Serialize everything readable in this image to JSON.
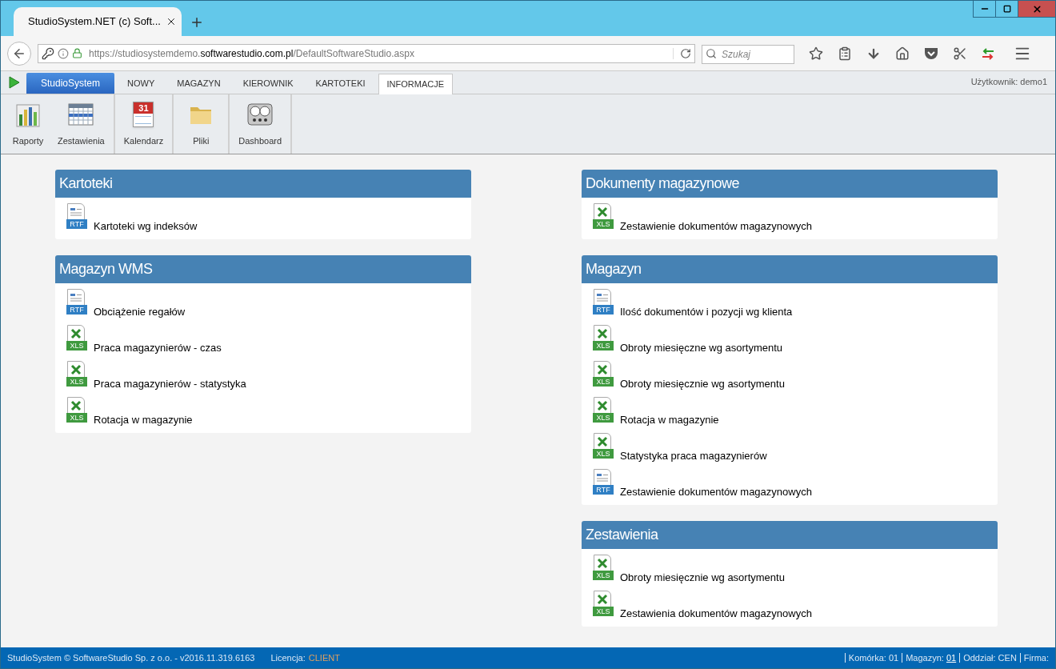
{
  "browser": {
    "tab_title": "StudioSystem.NET (c) Soft...",
    "url_prefix": "https://studiosystemdemo.",
    "url_domain": "softwarestudio.com.pl",
    "url_path": "/DefaultSoftwareStudio.aspx",
    "search_placeholder": "Szukaj"
  },
  "app_menu": {
    "brand": "StudioSystem",
    "tabs": [
      {
        "label": "NOWY",
        "selected": false
      },
      {
        "label": "MAGAZYN",
        "selected": false
      },
      {
        "label": "KIEROWNIK",
        "selected": false
      },
      {
        "label": "KARTOTEKI",
        "selected": false
      },
      {
        "label": "INFORMACJE",
        "selected": true
      }
    ],
    "user": "Użytkownik: demo1"
  },
  "ribbon": [
    {
      "items": [
        {
          "kind": "chart",
          "label": "Raporty"
        },
        {
          "kind": "grid",
          "label": "Zestawienia"
        }
      ]
    },
    {
      "items": [
        {
          "kind": "calendar",
          "label": "Kalendarz",
          "badge": "31"
        }
      ]
    },
    {
      "items": [
        {
          "kind": "folder",
          "label": "Pliki"
        }
      ]
    },
    {
      "items": [
        {
          "kind": "gauges",
          "label": "Dashboard"
        }
      ]
    }
  ],
  "columns": [
    [
      {
        "title": "Kartoteki",
        "items": [
          {
            "kind": "rtf",
            "badge": "RTF",
            "label": "Kartoteki wg indeksów"
          }
        ]
      },
      {
        "title": "Magazyn WMS",
        "items": [
          {
            "kind": "rtf",
            "badge": "RTF",
            "label": "Obciążenie regałów"
          },
          {
            "kind": "xls",
            "badge": "XLS",
            "label": "Praca magazynierów - czas"
          },
          {
            "kind": "xls",
            "badge": "XLS",
            "label": "Praca magazynierów - statystyka"
          },
          {
            "kind": "xls",
            "badge": "XLS",
            "label": "Rotacja w magazynie"
          }
        ]
      }
    ],
    [
      {
        "title": "Dokumenty magazynowe",
        "items": [
          {
            "kind": "xls",
            "badge": "XLS",
            "label": "Zestawienie dokumentów magazynowych"
          }
        ]
      },
      {
        "title": "Magazyn",
        "items": [
          {
            "kind": "rtf",
            "badge": "RTF",
            "label": "Ilość dokumentów i pozycji wg klienta"
          },
          {
            "kind": "xls",
            "badge": "XLS",
            "label": "Obroty miesięczne wg asortymentu"
          },
          {
            "kind": "xls",
            "badge": "XLS",
            "label": "Obroty miesięcznie wg asortymentu"
          },
          {
            "kind": "xls",
            "badge": "XLS",
            "label": "Rotacja w magazynie"
          },
          {
            "kind": "xls",
            "badge": "XLS",
            "label": "Statystyka praca magazynierów"
          },
          {
            "kind": "rtf",
            "badge": "RTF",
            "label": "Zestawienie dokumentów magazynowych"
          }
        ]
      },
      {
        "title": "Zestawienia",
        "items": [
          {
            "kind": "xls",
            "badge": "XLS",
            "label": "Obroty miesięcznie wg asortymentu"
          },
          {
            "kind": "xls",
            "badge": "XLS",
            "label": "Zestawienia dokumentów magazynowych"
          }
        ]
      }
    ]
  ],
  "status_bar": {
    "copyright": "StudioSystem © SoftwareStudio Sp. z o.o. - v2016.11.319.6163",
    "license_label": "Licencja:",
    "license_value": "CLIENT",
    "fields": [
      {
        "label": "Komórka: 01"
      },
      {
        "label": "Magazyn:",
        "link": "01"
      },
      {
        "label": "Oddział: CEN"
      },
      {
        "label": "Firma:"
      }
    ]
  }
}
